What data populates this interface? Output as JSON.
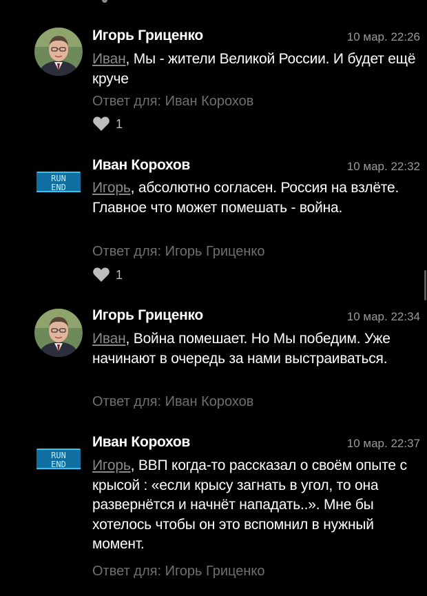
{
  "comments": [
    {
      "author": "Игорь Гриценко",
      "date": "10 мар. 22:26",
      "mention": "Иван",
      "text": ", Мы - жители Великой России. И будет ещё круче",
      "reply_to": "Ответ для: Иван Корохов",
      "likes": "1",
      "avatar_icon": "person-photo-icon"
    },
    {
      "author": "Иван Корохов",
      "date": "10 мар. 22:32",
      "mention": "Игорь",
      "text": ", абсолютно согласен. Россия на взлёте. Главное что может помешать - война.",
      "reply_to": "Ответ для: Игорь Гриценко",
      "likes": "1",
      "avatar_icon": "run-end-logo-icon",
      "avatar_text_1": "RUN",
      "avatar_text_2": "END"
    },
    {
      "author": "Игорь Гриценко",
      "date": "10 мар. 22:34",
      "mention": "Иван",
      "text": ", Война помешает. Но Мы победим. Уже начинают в очередь за нами выстраиваться.",
      "reply_to": "Ответ для: Иван Корохов",
      "avatar_icon": "person-photo-icon"
    },
    {
      "author": "Иван Корохов",
      "date": "10 мар. 22:37",
      "mention": "Игорь",
      "text": ", ВВП когда-то рассказал о своём опыте с крысой : «если крысу загнать в угол, то она развернётся и начнёт нападать..». Мне бы хотелось чтобы он это вспомнил в нужный момент.",
      "reply_to": "Ответ для: Игорь Гриценко",
      "avatar_icon": "run-end-logo-icon",
      "avatar_text_1": "RUN",
      "avatar_text_2": "END"
    }
  ],
  "colors": {
    "background": "#000000",
    "text": "#ffffff",
    "secondary": "#9a9a9a",
    "mention": "#8a8a8a",
    "logo": "#12a7e0"
  }
}
